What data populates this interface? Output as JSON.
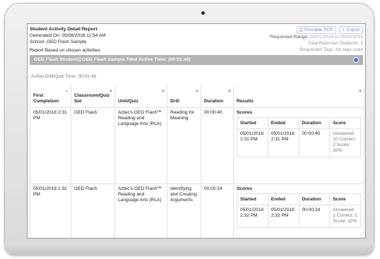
{
  "report": {
    "title": "Student Activity Detail Report",
    "generated": "Generated On: 05/08/2018 11:54 AM",
    "school": "School: GED Flash Sample",
    "tools": {
      "pdf": "Printable PDF",
      "export": "Export"
    },
    "requested_range_label": "Requested Range:",
    "requested_range_value": "05/01/2018 to 05/08/2018",
    "total_students": "Total Reported Students: 1",
    "requested_tags": "Requested Tags: No tags used",
    "based_on": "Report Based on chosen activities."
  },
  "section": {
    "title": "GED Flash Student@GED Flash Sample Total Active Time: (00:01:48)",
    "active_time": "Active Drill/Quiz Time: 00:01:48"
  },
  "table": {
    "headers": [
      "First Completion",
      "Classroom/Quiz Set",
      "Unit/Quiz",
      "Drill",
      "Duration",
      "Results"
    ],
    "scores_label": "Scores",
    "score_headers": [
      "Started",
      "Ended",
      "Duration",
      "Score"
    ],
    "rows": [
      {
        "first_completion": "05/01/2018 2:31 PM",
        "set": "GED Flash",
        "unit": "Aztec's GED Flash™ Reading and Language Arts (RLA)",
        "drill": "Reading for Meaning",
        "duration": "00:00:40",
        "score": {
          "started": "05/01/2018 2:31 PM",
          "ended": "05/01/2018 2:31 PM",
          "duration": "00:00:40",
          "score": "Answered: 10 Correct: 2 Score: 20%"
        }
      },
      {
        "first_completion": "05/01/2018 2:32 PM",
        "set": "GED Flash",
        "unit": "Aztec's GED Flash™ Reading and Language Arts (RLA)",
        "drill": "Identifying and Creating Arguments",
        "duration": "00:00:24",
        "score": {
          "started": "05/01/2018 2:32 PM",
          "ended": "05/01/2018 2:32 PM",
          "duration": "00:00:24",
          "score": "Answered: 1 Correct: 1 Score: 10%"
        }
      }
    ]
  },
  "icons": {
    "sort": "sort-icon",
    "toggle": "collapse-toggle-icon",
    "pdf": "pdf-icon",
    "export": "export-icon"
  },
  "colors": {
    "section_bar": "#b3b3b3",
    "toggle": "#4f6fd0",
    "link": "#7a8fd8"
  }
}
